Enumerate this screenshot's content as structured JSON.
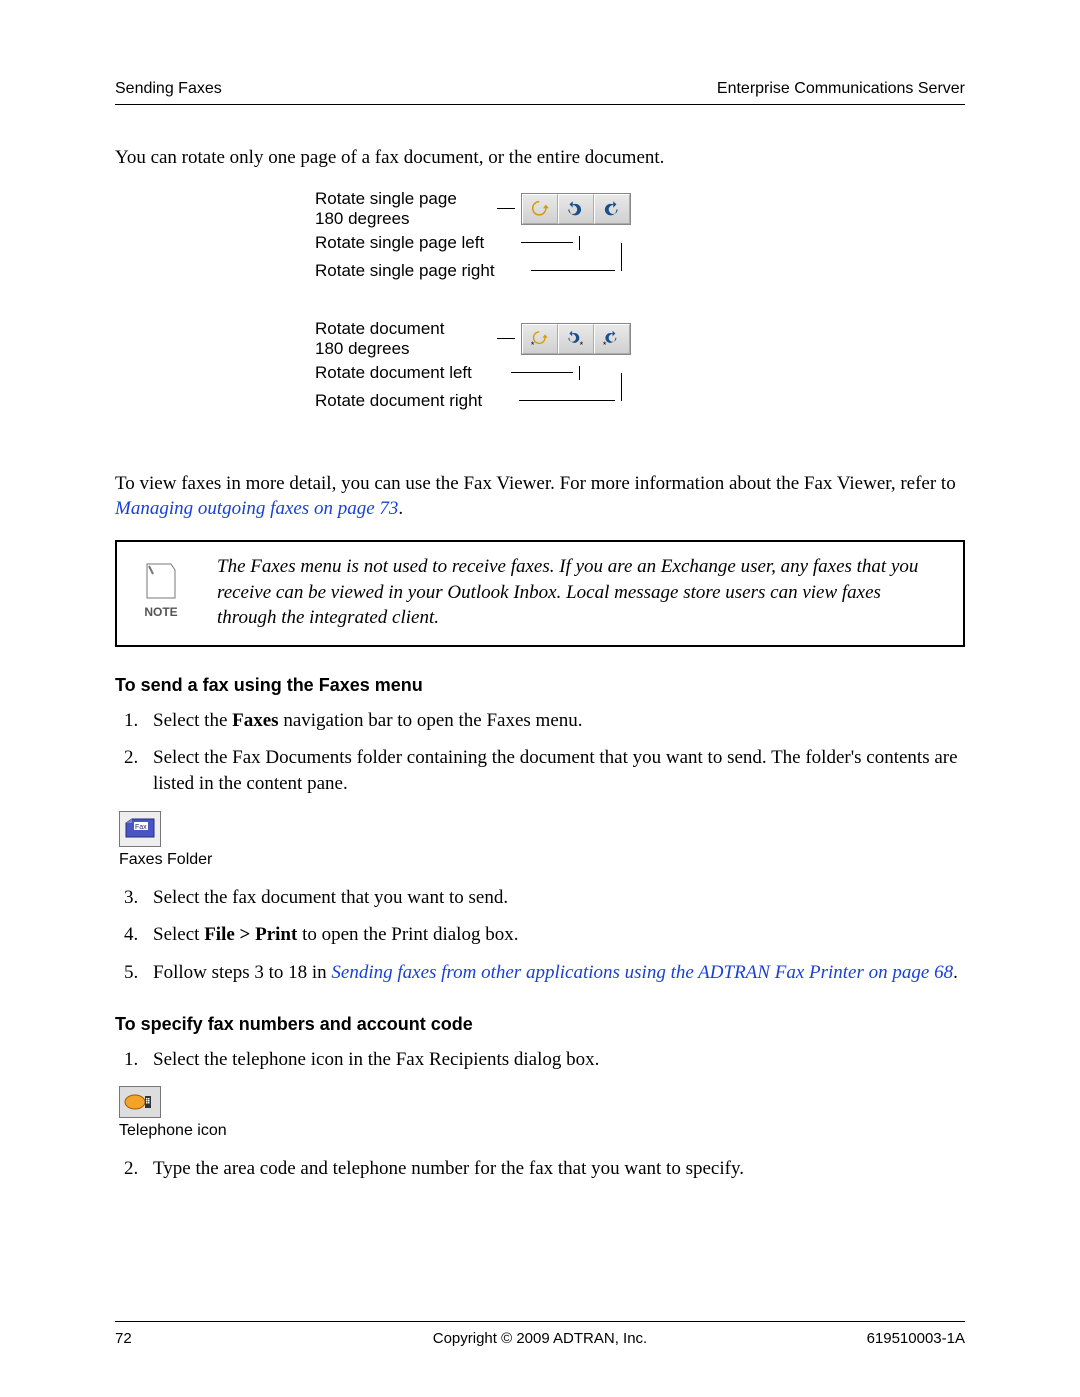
{
  "header": {
    "left": "Sending Faxes",
    "right": "Enterprise Communications Server"
  },
  "intro": "You can rotate only one page of a fax document, or the entire document.",
  "diagram1": {
    "row1": "Rotate single page\n180 degrees",
    "row2": "Rotate single page left",
    "row3": "Rotate single page right"
  },
  "diagram2": {
    "row1": "Rotate document\n180 degrees",
    "row2": "Rotate document left",
    "row3": "Rotate document right"
  },
  "para2_pre": "To view faxes in more detail, you can use the Fax Viewer. For more information about the Fax Viewer, refer to ",
  "para2_link": "Managing outgoing faxes on page 73",
  "para2_post": ".",
  "note": {
    "tag": "NOTE",
    "text": "The Faxes menu is not used to receive faxes. If you are an Exchange user, any faxes that you receive can be viewed in your Outlook Inbox. Local message store users can view faxes through the integrated client."
  },
  "sectionA": {
    "heading": "To send a fax using the Faxes menu",
    "steps": {
      "s1a": "Select the ",
      "s1b": "Faxes",
      "s1c": " navigation bar to open the Faxes menu.",
      "s2": "Select the Fax Documents folder containing the document that you want to send. The folder's contents are listed in the content pane.",
      "s3": "Select the fax document that you want to send.",
      "s4a": "Select ",
      "s4b": "File > Print",
      "s4c": " to open the Print dialog box.",
      "s5a": "Follow steps 3 to 18 in ",
      "s5link": "Sending faxes from other applications using the ADTRAN Fax Printer on page 68",
      "s5c": "."
    },
    "folder_icon_label": "Fax",
    "folder_caption": "Faxes Folder"
  },
  "sectionB": {
    "heading": "To specify fax numbers and account code",
    "steps": {
      "s1": "Select the telephone icon in the Fax Recipients dialog box.",
      "s2": "Type the area code and telephone number for the fax that you want to specify."
    },
    "phone_caption": "Telephone icon"
  },
  "footer": {
    "page": "72",
    "copyright": "Copyright © 2009 ADTRAN, Inc.",
    "docnum": "619510003-1A"
  }
}
